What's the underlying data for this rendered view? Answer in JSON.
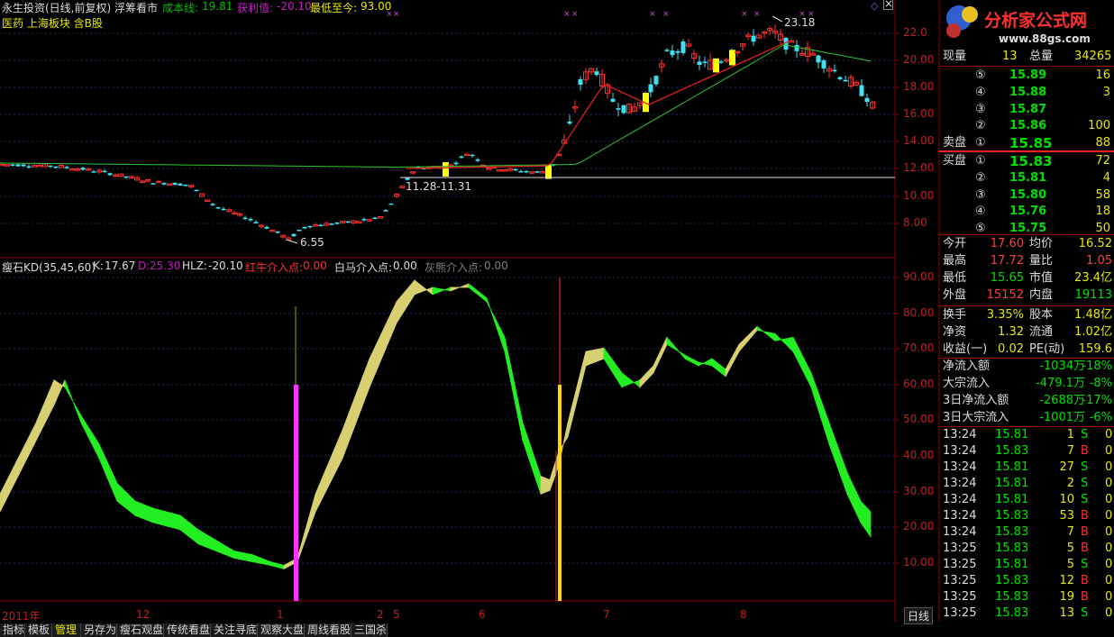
{
  "header": {
    "stock": "永生投资(日线,前复权) 浮筹看市",
    "cost_label": "成本线:",
    "cost_value": "19.81",
    "profit_label": "获利值:",
    "profit_value": "-20.10",
    "low_label": "最低至今:",
    "low_value": "93.00",
    "sector": "医药 上海板块 含B股"
  },
  "main_chart": {
    "price_ticks": [
      "22.0",
      "20.00",
      "18.00",
      "16.00",
      "14.00",
      "12.00",
      "10.00",
      "8.00"
    ],
    "annot_high": "23.18",
    "annot_low": "6.55",
    "annot_range": "11.28-11.31"
  },
  "indicator": {
    "name": "瘦石KD(35,45,60)",
    "k_label": "K:",
    "k_value": "17.67",
    "d_label": "D:",
    "d_value": "25.30",
    "hlz_label": "HLZ:",
    "hlz_value": "-20.10",
    "red_label": "红牛介入点:",
    "red_value": "0.00",
    "white_label": "白马介入点:",
    "white_value": "0.00",
    "gray_label": "灰熊介入点:",
    "gray_value": "0.00",
    "ticks": [
      "90.00",
      "80.00",
      "70.00",
      "60.00",
      "50.00",
      "40.00",
      "30.00",
      "20.00",
      "10.00"
    ]
  },
  "time_axis": {
    "labels": [
      "2011年",
      "12",
      "1",
      "2",
      "5",
      "6",
      "7",
      "8"
    ],
    "period_button": "日线"
  },
  "bottom_tabs": [
    "指标",
    "模板",
    "管理",
    "另存为",
    "瘦石观盘",
    "传统看盘",
    "关注寻底",
    "观察大盘",
    "周线看股",
    "三国杀"
  ],
  "logo": {
    "text": "分析家公式网",
    "url": "www.88gs.com"
  },
  "quote": {
    "volume_now_label": "现量",
    "volume_now": "13",
    "volume_total_label": "总量",
    "volume_total": "34265",
    "asks": [
      {
        "level": "⑤",
        "price": "15.89",
        "vol": "16"
      },
      {
        "level": "④",
        "price": "15.88",
        "vol": "3"
      },
      {
        "level": "③",
        "price": "15.87",
        "vol": ""
      },
      {
        "level": "②",
        "price": "15.86",
        "vol": "100"
      },
      {
        "level": "①",
        "price": "15.85",
        "vol": "88"
      }
    ],
    "ask_label": "卖盘",
    "bid_label": "买盘",
    "bids": [
      {
        "level": "①",
        "price": "15.83",
        "vol": "72"
      },
      {
        "level": "②",
        "price": "15.81",
        "vol": "4"
      },
      {
        "level": "③",
        "price": "15.80",
        "vol": "58"
      },
      {
        "level": "④",
        "price": "15.76",
        "vol": "18"
      },
      {
        "level": "⑤",
        "price": "15.75",
        "vol": "50"
      }
    ],
    "stats": [
      {
        "l1": "今开",
        "v1": "17.60",
        "c1": "#ff4040",
        "l2": "均价",
        "v2": "16.52",
        "c2": "#e8e800"
      },
      {
        "l1": "最高",
        "v1": "17.72",
        "c1": "#ff4040",
        "l2": "量比",
        "v2": "1.05",
        "c2": "#ff4040"
      },
      {
        "l1": "最低",
        "v1": "15.65",
        "c1": "#00e000",
        "l2": "市值",
        "v2": "23.4亿",
        "c2": "#e8e800"
      },
      {
        "l1": "外盘",
        "v1": "15152",
        "c1": "#ff4040",
        "l2": "内盘",
        "v2": "19113",
        "c2": "#00e000"
      }
    ],
    "finance": [
      {
        "l1": "换手",
        "v1": "3.35%",
        "l2": "股本",
        "v2": "1.48亿"
      },
      {
        "l1": "净资",
        "v1": "1.32",
        "l2": "流通",
        "v2": "1.02亿"
      },
      {
        "l1": "收益(一)",
        "v1": "0.02",
        "l2": "PE(动)",
        "v2": "159.6"
      }
    ],
    "flows": [
      {
        "label": "净流入额",
        "amount": "-1034万",
        "pct": "-18%"
      },
      {
        "label": "大宗流入",
        "amount": "-479.1万",
        "pct": "-8%"
      },
      {
        "label": "3日净流入额",
        "amount": "-2688万",
        "pct": "-17%"
      },
      {
        "label": "3日大宗流入",
        "amount": "-1001万",
        "pct": "-6%"
      }
    ],
    "ticks": [
      {
        "time": "13:24",
        "price": "15.81",
        "vol": "1",
        "side": "S",
        "n": "0"
      },
      {
        "time": "13:24",
        "price": "15.83",
        "vol": "7",
        "side": "B",
        "n": "0"
      },
      {
        "time": "13:24",
        "price": "15.81",
        "vol": "27",
        "side": "S",
        "n": "0"
      },
      {
        "time": "13:24",
        "price": "15.81",
        "vol": "2",
        "side": "S",
        "n": "0"
      },
      {
        "time": "13:24",
        "price": "15.81",
        "vol": "10",
        "side": "S",
        "n": "0"
      },
      {
        "time": "13:24",
        "price": "15.83",
        "vol": "53",
        "side": "B",
        "n": "0"
      },
      {
        "time": "13:24",
        "price": "15.83",
        "vol": "7",
        "side": "B",
        "n": "0"
      },
      {
        "time": "13:25",
        "price": "15.83",
        "vol": "5",
        "side": "B",
        "n": "0"
      },
      {
        "time": "13:25",
        "price": "15.81",
        "vol": "5",
        "side": "S",
        "n": "0"
      },
      {
        "time": "13:25",
        "price": "15.83",
        "vol": "12",
        "side": "B",
        "n": "0"
      },
      {
        "time": "13:25",
        "price": "15.83",
        "vol": "19",
        "side": "B",
        "n": "0"
      },
      {
        "time": "13:25",
        "price": "15.83",
        "vol": "13",
        "side": "S",
        "n": "0"
      }
    ]
  }
}
